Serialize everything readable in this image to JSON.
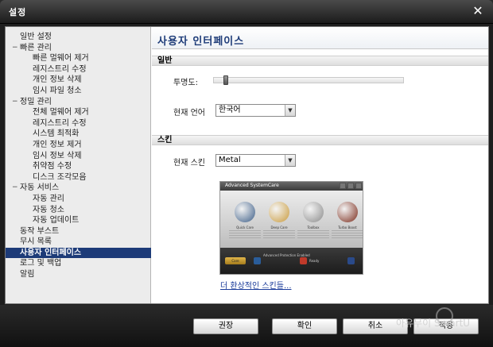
{
  "window": {
    "title": "설정",
    "close_symbol": "✕"
  },
  "sidebar": {
    "items": [
      {
        "label": "일반 설정",
        "level": 0,
        "toggle": ""
      },
      {
        "label": "빠른 관리",
        "level": 0,
        "toggle": "−"
      },
      {
        "label": "빠른 멀웨어 제거",
        "level": 1,
        "toggle": ""
      },
      {
        "label": "레지스트리 수정",
        "level": 1,
        "toggle": ""
      },
      {
        "label": "개인 정보 삭제",
        "level": 1,
        "toggle": ""
      },
      {
        "label": "임시 파일 청소",
        "level": 1,
        "toggle": ""
      },
      {
        "label": "정밀 관리",
        "level": 0,
        "toggle": "−"
      },
      {
        "label": "전체 멀웨어 제거",
        "level": 1,
        "toggle": ""
      },
      {
        "label": "레지스트리 수정",
        "level": 1,
        "toggle": ""
      },
      {
        "label": "시스템 최적화",
        "level": 1,
        "toggle": ""
      },
      {
        "label": "개인 정보 제거",
        "level": 1,
        "toggle": ""
      },
      {
        "label": "임시 정보 삭제",
        "level": 1,
        "toggle": ""
      },
      {
        "label": "취약점 수정",
        "level": 1,
        "toggle": ""
      },
      {
        "label": "디스크 조각모음",
        "level": 1,
        "toggle": ""
      },
      {
        "label": "자동 서비스",
        "level": 0,
        "toggle": "−"
      },
      {
        "label": "자동 관리",
        "level": 1,
        "toggle": ""
      },
      {
        "label": "자동 청소",
        "level": 1,
        "toggle": ""
      },
      {
        "label": "자동 업데이트",
        "level": 1,
        "toggle": ""
      },
      {
        "label": "동작 부스트",
        "level": 0,
        "toggle": ""
      },
      {
        "label": "무시 목록",
        "level": 0,
        "toggle": ""
      },
      {
        "label": "사용자 인터페이스",
        "level": 0,
        "toggle": "",
        "selected": true
      },
      {
        "label": "로그 및 백업",
        "level": 0,
        "toggle": ""
      },
      {
        "label": "알림",
        "level": 0,
        "toggle": ""
      }
    ]
  },
  "panel": {
    "title": "사용자 인터페이스",
    "general": {
      "section_label": "일반",
      "opacity_label": "투명도:",
      "opacity_value": 0.05,
      "language_label": "현재 언어",
      "language_value": "한국어"
    },
    "skin": {
      "section_label": "스킨",
      "skin_label": "현재 스킨",
      "skin_value": "Metal",
      "preview": {
        "title": "Advanced SystemCare",
        "items": [
          "Quick Care",
          "Deep Care",
          "Toolbox",
          "Turbo Boost"
        ],
        "button": "Care",
        "status_text": "Advanced Protection Enabled",
        "status_sub": "Ready",
        "icon_colors": [
          "#3b5c86",
          "#c99a3a",
          "#8a8a8a",
          "#7a2a1a"
        ]
      },
      "more_link": "더 환상적인 스킨들..."
    }
  },
  "buttons": {
    "recommend": "권장",
    "ok": "확인",
    "cancel": "취소",
    "apply": "적용"
  },
  "watermark": {
    "text": "아유무이 SmartU"
  }
}
